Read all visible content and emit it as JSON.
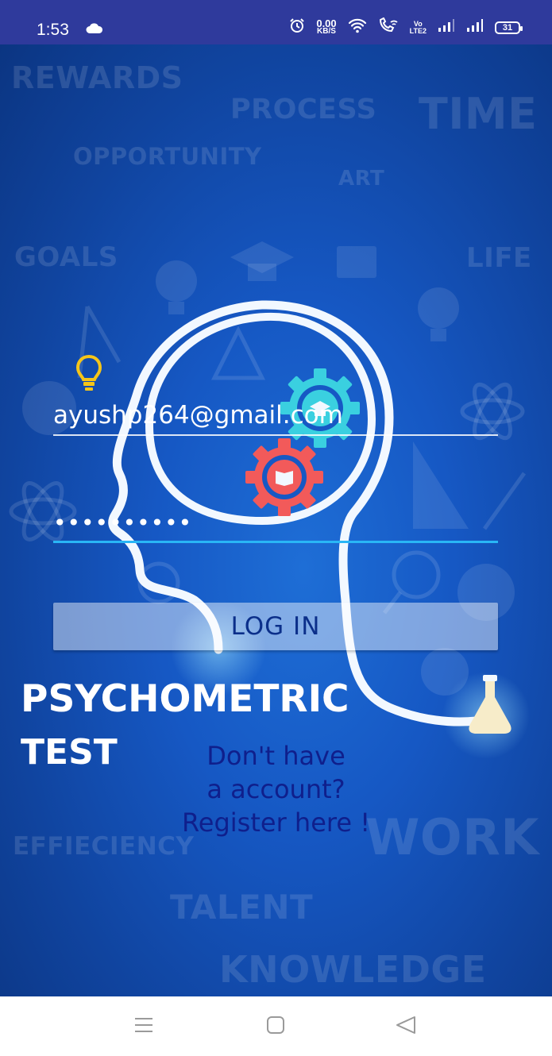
{
  "status_bar": {
    "time": "1:53",
    "net_speed_value": "0.00",
    "net_speed_unit": "KB/S",
    "volte_top": "Vo",
    "volte_bottom": "LTE2",
    "battery": "31"
  },
  "background_words": [
    "REWARDS",
    "PROCESS",
    "TIME",
    "OPPORTUNITY",
    "ART",
    "GOALS",
    "LIFE",
    "EFFIECIENCY",
    "WORK",
    "TALENT",
    "KNOWLEDGE"
  ],
  "login_form": {
    "email_value": "ayushp264@gmail.com",
    "password_value": "••••••••••"
  },
  "login_button": {
    "label": "LOG IN"
  },
  "title": {
    "line1": "PSYCHOMETRIC",
    "line2": "TEST"
  },
  "register_link": {
    "line1": "Don't have",
    "line2": "a account?",
    "line3": "Register here !"
  },
  "colors": {
    "status_bar": "#2f3a9c",
    "background": "#1658c4",
    "active_underline": "#29b6f6",
    "register_text": "#0f1f8c",
    "gear_cyan": "#3ad0e0",
    "gear_red": "#f25a5a"
  },
  "icons": [
    "cloud-icon",
    "alarm-icon",
    "wifi-icon",
    "wifi-calling-icon",
    "signal-icon",
    "battery-icon",
    "lightbulb-icon",
    "gear-graduation-icon",
    "gear-book-icon",
    "flask-icon",
    "menu-icon",
    "home-icon",
    "back-icon"
  ]
}
